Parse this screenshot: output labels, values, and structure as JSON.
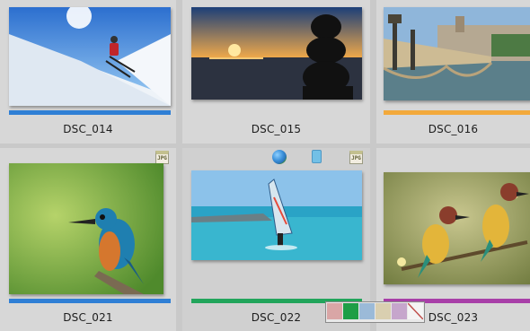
{
  "grid": {
    "items": [
      {
        "label": "DSC_014",
        "color_tag": "#2f7fd5",
        "icons": []
      },
      {
        "label": "DSC_015",
        "color_tag": "",
        "icons": []
      },
      {
        "label": "DSC_016",
        "color_tag": "#f2a93b",
        "icons": []
      },
      {
        "label": "DSC_021",
        "color_tag": "#2f7fd5",
        "icons": [
          "jpg-icon"
        ]
      },
      {
        "label": "DSC_022",
        "color_tag": "#22a55b",
        "icons": [
          "globe-icon",
          "rotate-icon",
          "jpg-icon"
        ],
        "selected": true
      },
      {
        "label": "DSC_023",
        "color_tag": "#a83fa8",
        "icons": []
      }
    ]
  },
  "icons": {
    "jpg_text": "JPG"
  },
  "color_palette": {
    "swatches": [
      "#d9a6a6",
      "#1e9e46",
      "#9bbad8",
      "#d9cfb0",
      "#c6a6cc",
      "none"
    ]
  }
}
